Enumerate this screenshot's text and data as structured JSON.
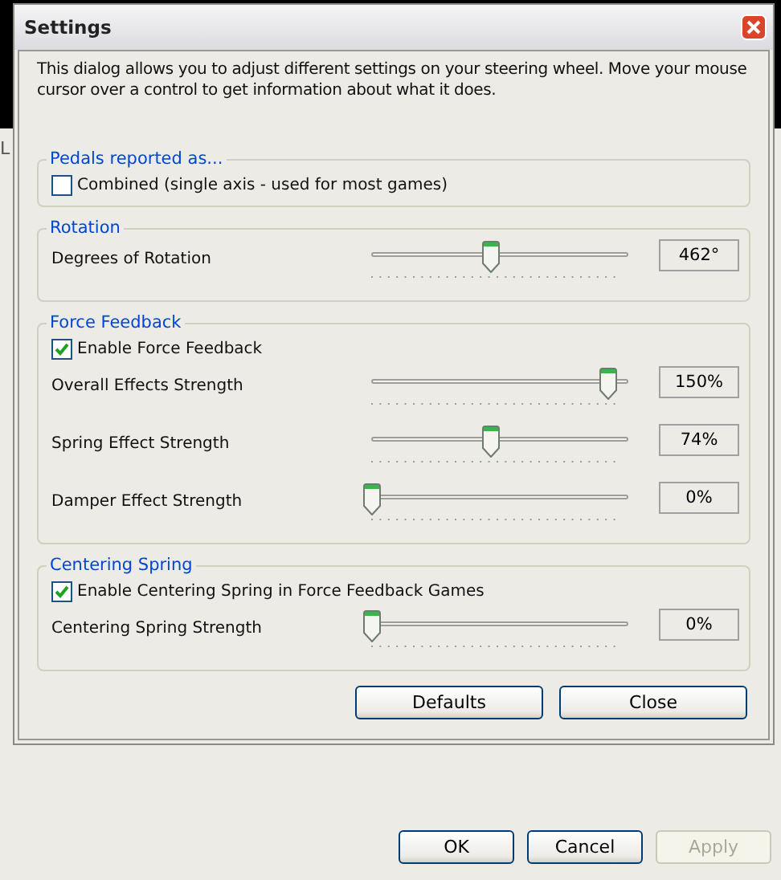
{
  "background_window": {
    "title_fragment": "L",
    "buttons": [
      {
        "label": "OK",
        "disabled": false
      },
      {
        "label": "Cancel",
        "disabled": false
      },
      {
        "label": "Apply",
        "disabled": true
      }
    ]
  },
  "window": {
    "title": "Settings"
  },
  "intro": "This dialog allows you to adjust different settings on your steering wheel.  Move your mouse cursor over a control to get information about what it does.",
  "groups": [
    {
      "title": "Pedals reported as...",
      "items": [
        {
          "kind": "checkbox",
          "label": "Combined (single axis - used for most games)",
          "checked": false
        }
      ]
    },
    {
      "title": "Rotation",
      "items": [
        {
          "kind": "slider",
          "label": "Degrees of Rotation",
          "level": 0.49,
          "reading": "462°"
        }
      ]
    },
    {
      "title": "Force Feedback",
      "items": [
        {
          "kind": "checkbox",
          "label": "Enable Force Feedback",
          "checked": true
        },
        {
          "kind": "slider",
          "label": "Overall Effects Strength",
          "level": 0.97,
          "reading": "150%"
        },
        {
          "kind": "slider",
          "label": "Spring Effect Strength",
          "level": 0.49,
          "reading": "74%"
        },
        {
          "kind": "slider",
          "label": "Damper Effect Strength",
          "level": 0,
          "reading": "0%"
        }
      ]
    },
    {
      "title": "Centering Spring",
      "items": [
        {
          "kind": "checkbox",
          "label": "Enable Centering Spring in Force Feedback Games",
          "checked": true
        },
        {
          "kind": "slider",
          "label": "Centering Spring Strength",
          "level": 0,
          "reading": "0%"
        }
      ]
    }
  ],
  "buttons": [
    "Defaults",
    "Close"
  ]
}
